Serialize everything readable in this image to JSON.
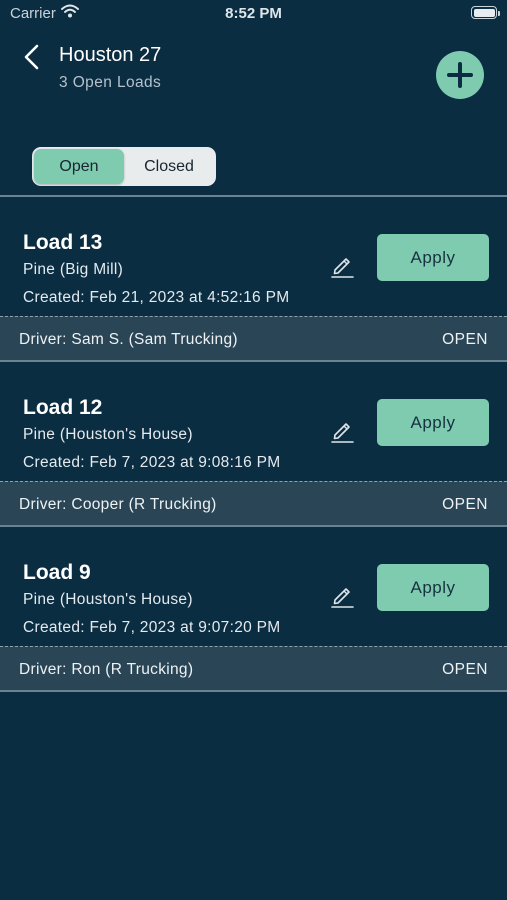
{
  "status_bar": {
    "carrier": "Carrier",
    "time": "8:52 PM"
  },
  "header": {
    "title": "Houston 27",
    "subtitle": "3 Open Loads"
  },
  "tabs": {
    "open": "Open",
    "closed": "Closed"
  },
  "loads": [
    {
      "title": "Load 13",
      "wood": "Pine (Big Mill)",
      "created": "Created: Feb 21, 2023 at 4:52:16 PM",
      "apply": "Apply",
      "driver": "Driver: Sam S. (Sam Trucking)",
      "status": "OPEN"
    },
    {
      "title": "Load 12",
      "wood": "Pine (Houston's House)",
      "created": "Created: Feb 7, 2023 at 9:08:16 PM",
      "apply": "Apply",
      "driver": "Driver: Cooper (R Trucking)",
      "status": "OPEN"
    },
    {
      "title": "Load 9",
      "wood": "Pine (Houston's House)",
      "created": "Created: Feb 7, 2023 at 9:07:20 PM",
      "apply": "Apply",
      "driver": "Driver: Ron (R Trucking)",
      "status": "OPEN"
    }
  ],
  "colors": {
    "background": "#0b2d42",
    "accent": "#7ecbb0",
    "footer": "#2a4656"
  },
  "icons": [
    "wifi-icon",
    "battery-icon",
    "back-icon",
    "plus-icon",
    "pencil-icon"
  ]
}
